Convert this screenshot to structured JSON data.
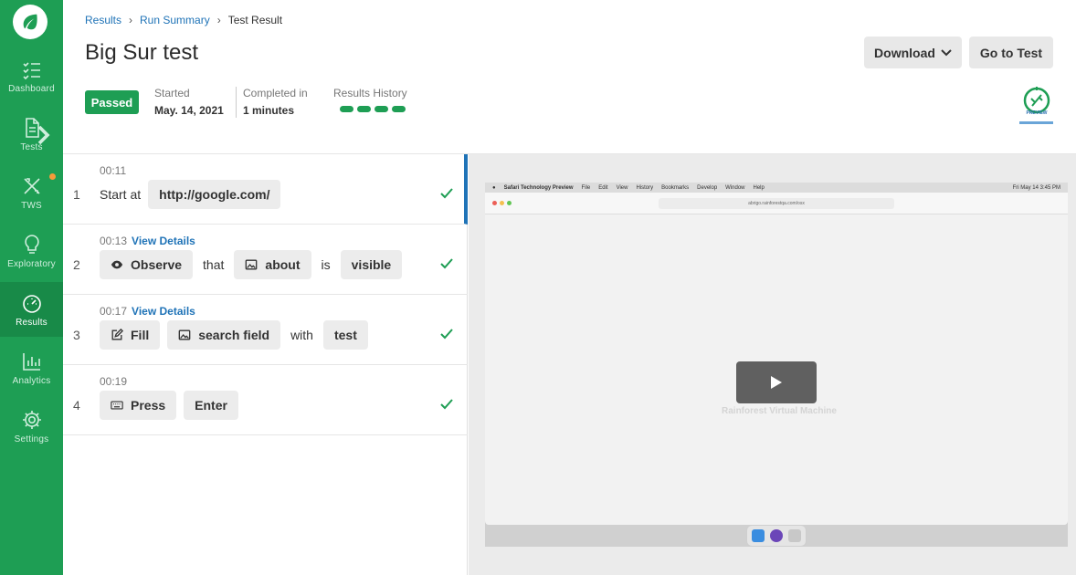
{
  "sidebar": {
    "items": [
      {
        "label": "Dashboard",
        "icon": "list-check-icon"
      },
      {
        "label": "Tests",
        "icon": "document-icon"
      },
      {
        "label": "TWS",
        "icon": "tools-icon"
      },
      {
        "label": "Exploratory",
        "icon": "lightbulb-icon"
      },
      {
        "label": "Results",
        "icon": "gauge-icon"
      },
      {
        "label": "Analytics",
        "icon": "bar-chart-icon"
      },
      {
        "label": "Settings",
        "icon": "gear-icon"
      }
    ],
    "active": "Results",
    "accent": "#1e9e54"
  },
  "breadcrumb": {
    "results": "Results",
    "run_summary": "Run Summary",
    "current": "Test Result"
  },
  "header": {
    "title": "Big Sur test",
    "download_label": "Download",
    "goto_label": "Go to Test",
    "status": "Passed",
    "started_label": "Started",
    "started_value": "May. 14, 2021",
    "completed_label": "Completed in",
    "completed_value": "1 minutes",
    "history_label": "Results History",
    "history": [
      "passed",
      "passed",
      "passed",
      "passed"
    ],
    "preview_text": "PREVIEW"
  },
  "steps": [
    {
      "num": "1",
      "time": "00:11",
      "details": "",
      "parts": {
        "a": "Start at",
        "b": "http://google.com/"
      }
    },
    {
      "num": "2",
      "time": "00:13",
      "details": "View Details",
      "parts": {
        "action": "Observe",
        "that": "that",
        "target": "about",
        "is": "is",
        "state": "visible"
      }
    },
    {
      "num": "3",
      "time": "00:17",
      "details": "View Details",
      "parts": {
        "action": "Fill",
        "target": "search field",
        "with": "with",
        "value": "test"
      }
    },
    {
      "num": "4",
      "time": "00:19",
      "details": "",
      "parts": {
        "action": "Press",
        "key": "Enter"
      }
    }
  ],
  "video": {
    "menubar": [
      "Safari Technology Preview",
      "File",
      "Edit",
      "View",
      "History",
      "Bookmarks",
      "Develop",
      "Window",
      "Help"
    ],
    "clock": "Fri May 14  3:45 PM",
    "url": "abrigo.rainforestqa.com/osx",
    "label": "Rainforest Virtual Machine"
  }
}
